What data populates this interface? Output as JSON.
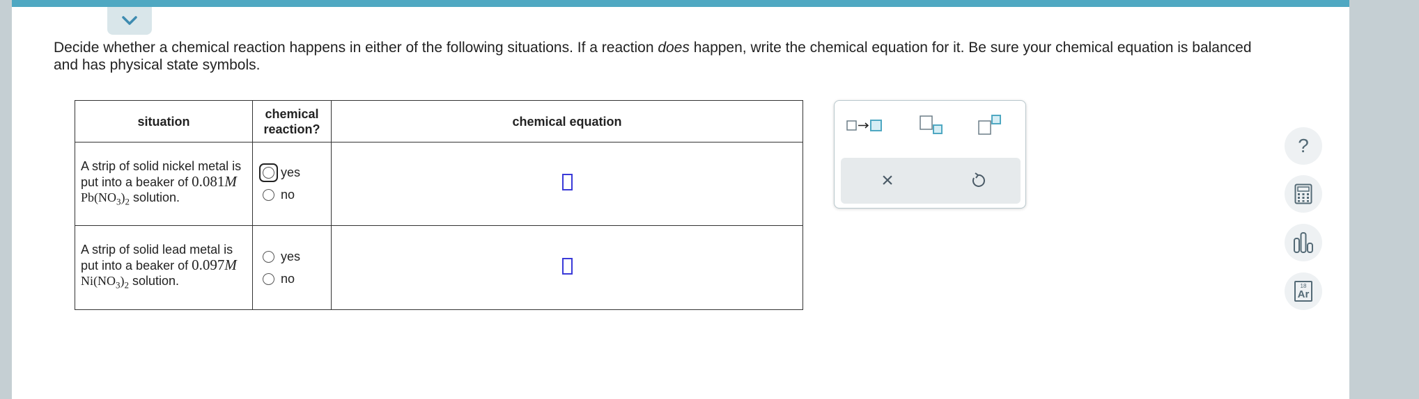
{
  "instructions": {
    "part1": "Decide whether a chemical reaction happens in either of the following situations. If a reaction ",
    "emphasis": "does",
    "part2": " happen, write the chemical equation for it. Be sure your chemical equation is balanced and has physical state symbols."
  },
  "table": {
    "headers": {
      "situation": "situation",
      "reaction_line1": "chemical",
      "reaction_line2": "reaction?",
      "equation": "chemical equation"
    },
    "rows": [
      {
        "text_before": "A strip of solid nickel metal is put into a beaker of ",
        "concentration": "0.081",
        "unit": "M",
        "formula_main": "Pb(NO",
        "formula_sub1": "3",
        "formula_close": ")",
        "formula_sub2": "2",
        "text_after": " solution.",
        "option_yes": "yes",
        "option_no": "no",
        "selected": "none",
        "focused": "yes"
      },
      {
        "text_before": "A strip of solid lead metal is put into a beaker of ",
        "concentration": "0.097",
        "unit": "M",
        "formula_main": "Ni(NO",
        "formula_sub1": "3",
        "formula_close": ")",
        "formula_sub2": "2",
        "text_after": " solution.",
        "option_yes": "yes",
        "option_no": "no",
        "selected": "none"
      }
    ]
  },
  "palette": {
    "buttons": [
      "reaction-arrow-template",
      "subscript-template",
      "superscript-template"
    ],
    "actions": {
      "clear": "×",
      "undo": "↺"
    }
  },
  "sidebar": {
    "help": "?",
    "periodic_element_number": "18",
    "periodic_element_symbol": "Ar"
  },
  "colors": {
    "top_bar": "#4fa8c2",
    "answer_box": "#3a3ad8",
    "palette_accent": "#4fa8c2"
  }
}
